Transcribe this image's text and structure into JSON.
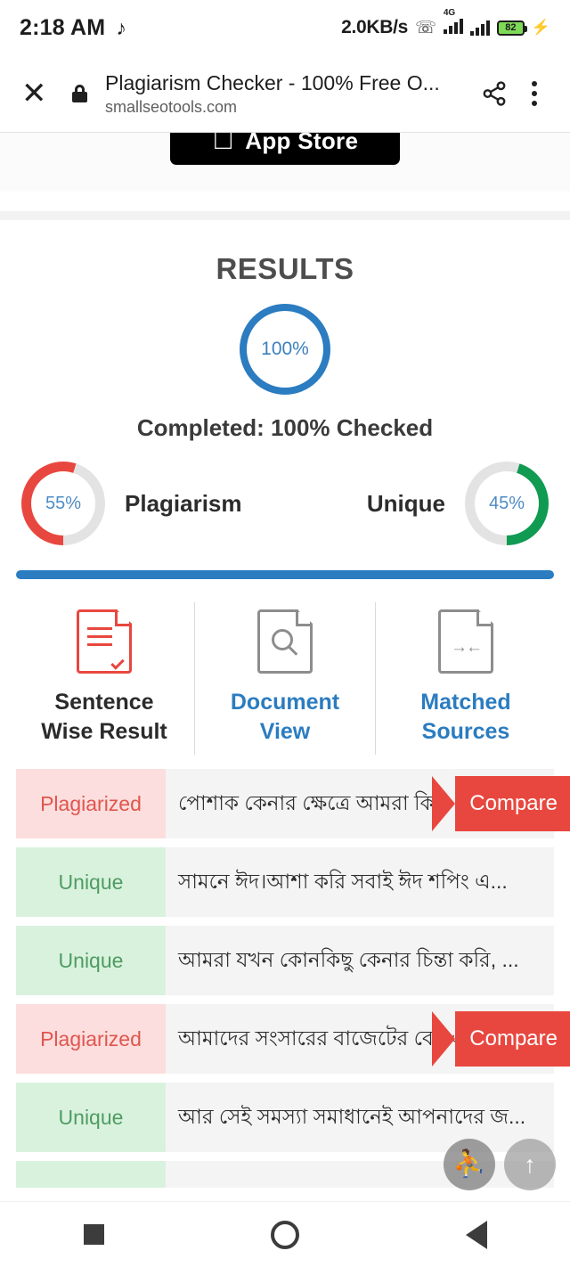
{
  "status_bar": {
    "time": "2:18 AM",
    "music_icon": "music-note-icon",
    "network_speed": "2.0KB/s",
    "headphone_icon": "headphones-icon",
    "network_type": "4G",
    "battery_percent": "82",
    "charging_icon": "lightning-bolt-icon"
  },
  "browser_bar": {
    "close_icon": "close-icon",
    "lock_icon": "lock-icon",
    "page_title": "Plagiarism Checker - 100% Free O...",
    "page_url": "smallseotools.com",
    "share_icon": "share-icon",
    "more_icon": "more-vertical-icon"
  },
  "app_store": {
    "label": "App Store",
    "apple_icon": "apple-logo-icon"
  },
  "results": {
    "heading": "RESULTS",
    "main_circle_value": "100%",
    "completed_text": "Completed: 100% Checked",
    "plagiarism": {
      "value": "55%",
      "label": "Plagiarism",
      "color": "#e8473f"
    },
    "unique": {
      "value": "45%",
      "label": "Unique",
      "color": "#119a52"
    },
    "progress_color": "#2b7cc0"
  },
  "view_options": [
    {
      "label_line1": "Sentence",
      "label_line2": "Wise Result",
      "icon": "document-check-icon",
      "active": true
    },
    {
      "label_line1": "Document",
      "label_line2": "View",
      "icon": "document-search-icon",
      "active": false
    },
    {
      "label_line1": "Matched",
      "label_line2": "Sources",
      "icon": "document-arrows-icon",
      "active": false
    }
  ],
  "sentence_rows": [
    {
      "tag": "Plagiarized",
      "type": "plag",
      "text": "পোশাক কেনার ক্ষেত্রে আমরা কিন্ত ...",
      "compare_label": "Compare",
      "has_compare": true
    },
    {
      "tag": "Unique",
      "type": "uniq",
      "text": "সামনে ঈদ।আশা করি সবাই ঈদ শপিং এ...",
      "compare_label": "",
      "has_compare": false
    },
    {
      "tag": "Unique",
      "type": "uniq",
      "text": "আমরা যখন কোনকিছু কেনার চিন্তা করি, ...",
      "compare_label": "",
      "has_compare": false
    },
    {
      "tag": "Plagiarized",
      "type": "plag",
      "text": "আমাদের সংসারের বাজেটের বেশ এ...",
      "compare_label": "Compare",
      "has_compare": true
    },
    {
      "tag": "Unique",
      "type": "uniq",
      "text": "আর সেই সমস্যা সমাধানেই আপনাদের জ...",
      "compare_label": "",
      "has_compare": false
    },
    {
      "tag": "",
      "type": "uniq",
      "text": "",
      "compare_label": "",
      "has_compare": false
    }
  ],
  "floating_buttons": {
    "accessibility_icon": "accessibility-icon",
    "scroll_top_icon": "arrow-up-icon",
    "scroll_top_label": "↑"
  },
  "nav_bar": {
    "recents_icon": "square-recents-icon",
    "home_icon": "circle-home-icon",
    "back_icon": "triangle-back-icon"
  }
}
